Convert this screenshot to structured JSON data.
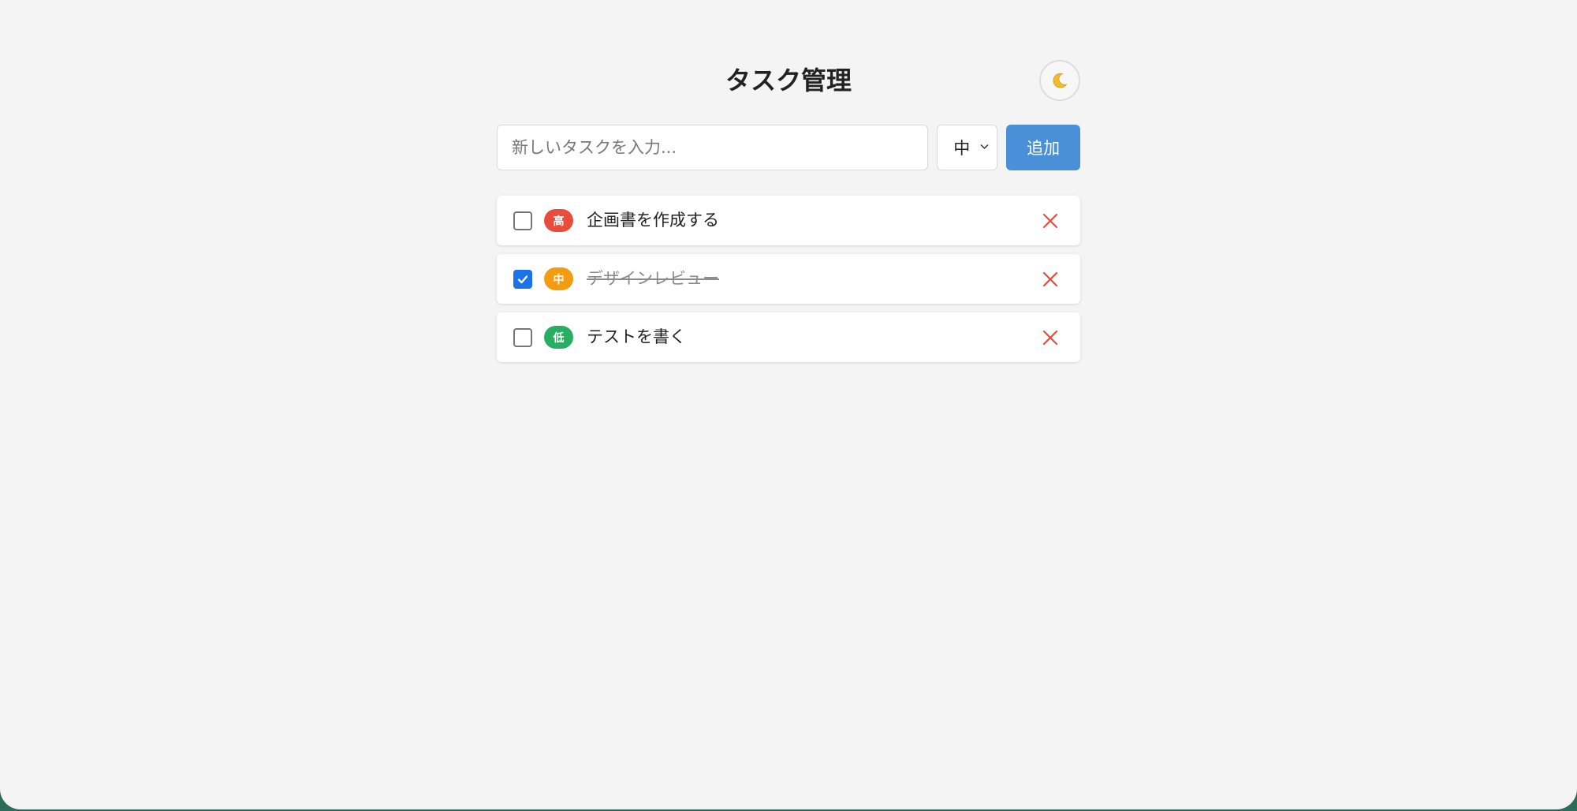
{
  "app": {
    "title": "タスク管理",
    "theme_toggle_icon": "moon-icon"
  },
  "add_form": {
    "placeholder": "新しいタスクを入力...",
    "input_value": "",
    "priority_selected": "中",
    "add_label": "追加"
  },
  "tasks": [
    {
      "text": "企画書を作成する",
      "priority": "高",
      "priority_color": "#e74c3c",
      "checked": false
    },
    {
      "text": "デザインレビュー",
      "priority": "中",
      "priority_color": "#f39c12",
      "checked": true
    },
    {
      "text": "テストを書く",
      "priority": "低",
      "priority_color": "#27ae60",
      "checked": false
    }
  ],
  "colors": {
    "accent": "#4a90d9",
    "delete": "#e74c3c",
    "checkbox_checked": "#1a73e8",
    "background": "#f4f4f4"
  }
}
